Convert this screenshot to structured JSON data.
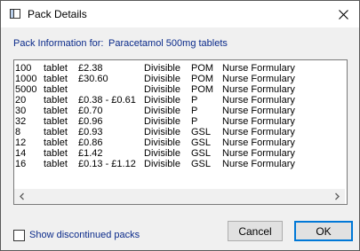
{
  "window": {
    "title": "Pack Details"
  },
  "header": {
    "label": "Pack Information for:",
    "drug": "Paracetamol 500mg tablets"
  },
  "packs": [
    {
      "qty": "100",
      "unit": "tablet",
      "price": "£2.38",
      "divisible": "Divisible",
      "class": "POM",
      "formulary": "Nurse Formulary"
    },
    {
      "qty": "1000",
      "unit": "tablet",
      "price": "£30.60",
      "divisible": "Divisible",
      "class": "POM",
      "formulary": "Nurse Formulary"
    },
    {
      "qty": "5000",
      "unit": "tablet",
      "price": "",
      "divisible": "Divisible",
      "class": "POM",
      "formulary": "Nurse Formulary"
    },
    {
      "qty": "20",
      "unit": "tablet",
      "price": "£0.38 - £0.61",
      "divisible": "Divisible",
      "class": "P",
      "formulary": "Nurse Formulary"
    },
    {
      "qty": "30",
      "unit": "tablet",
      "price": "£0.70",
      "divisible": "Divisible",
      "class": "P",
      "formulary": "Nurse Formulary"
    },
    {
      "qty": "32",
      "unit": "tablet",
      "price": "£0.96",
      "divisible": "Divisible",
      "class": "P",
      "formulary": "Nurse Formulary"
    },
    {
      "qty": "8",
      "unit": "tablet",
      "price": "£0.93",
      "divisible": "Divisible",
      "class": "GSL",
      "formulary": "Nurse Formulary"
    },
    {
      "qty": "12",
      "unit": "tablet",
      "price": "£0.86",
      "divisible": "Divisible",
      "class": "GSL",
      "formulary": "Nurse Formulary"
    },
    {
      "qty": "14",
      "unit": "tablet",
      "price": "£1.42",
      "divisible": "Divisible",
      "class": "GSL",
      "formulary": "Nurse Formulary"
    },
    {
      "qty": "16",
      "unit": "tablet",
      "price": "£0.13 - £1.12",
      "divisible": "Divisible",
      "class": "GSL",
      "formulary": "Nurse Formulary"
    }
  ],
  "options": {
    "show_discontinued_label": "Show discontinued packs",
    "show_discontinued_checked": false
  },
  "buttons": {
    "cancel": "Cancel",
    "ok": "OK"
  },
  "icons": {
    "app": "window-icon",
    "close": "close-icon",
    "scroll_left": "chevron-left-icon",
    "scroll_right": "chevron-right-icon"
  }
}
